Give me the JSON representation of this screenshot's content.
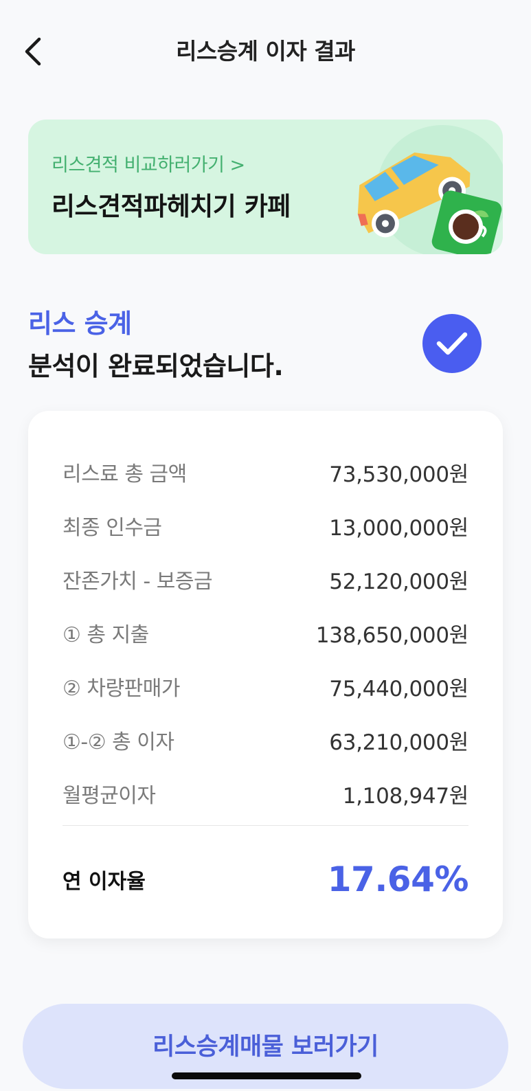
{
  "header": {
    "title": "리스승계 이자 결과"
  },
  "banner": {
    "subtitle": "리스견적 비교하러가기",
    "chevron": ">",
    "title": "리스견적파헤치기 카페"
  },
  "result": {
    "line1": "리스 승계",
    "line2": "분석이 완료되었습니다."
  },
  "summary": {
    "rows": [
      {
        "label": "리스료 총 금액",
        "value": "73,530,000원"
      },
      {
        "label": "최종 인수금",
        "value": "13,000,000원"
      },
      {
        "label": "잔존가치 - 보증금",
        "value": "52,120,000원"
      },
      {
        "label": "① 총 지출",
        "value": "138,650,000원"
      },
      {
        "label": "② 차량판매가",
        "value": "75,440,000원"
      },
      {
        "label": "①-② 총 이자",
        "value": "63,210,000원"
      },
      {
        "label": "월평균이자",
        "value": "1,108,947원"
      }
    ],
    "rate_label": "연 이자율",
    "rate_value": "17.64%"
  },
  "cta": {
    "label": "리스승계매물 보러가기"
  },
  "colors": {
    "accent": "#4a62e6",
    "banner_bg": "#d6f5e1",
    "banner_sub": "#44b070",
    "cta_bg": "#dde3fb"
  },
  "icons": {
    "back": "chevron-left-icon",
    "check": "check-icon",
    "car": "car-icon",
    "coffee": "coffee-cup-icon"
  }
}
